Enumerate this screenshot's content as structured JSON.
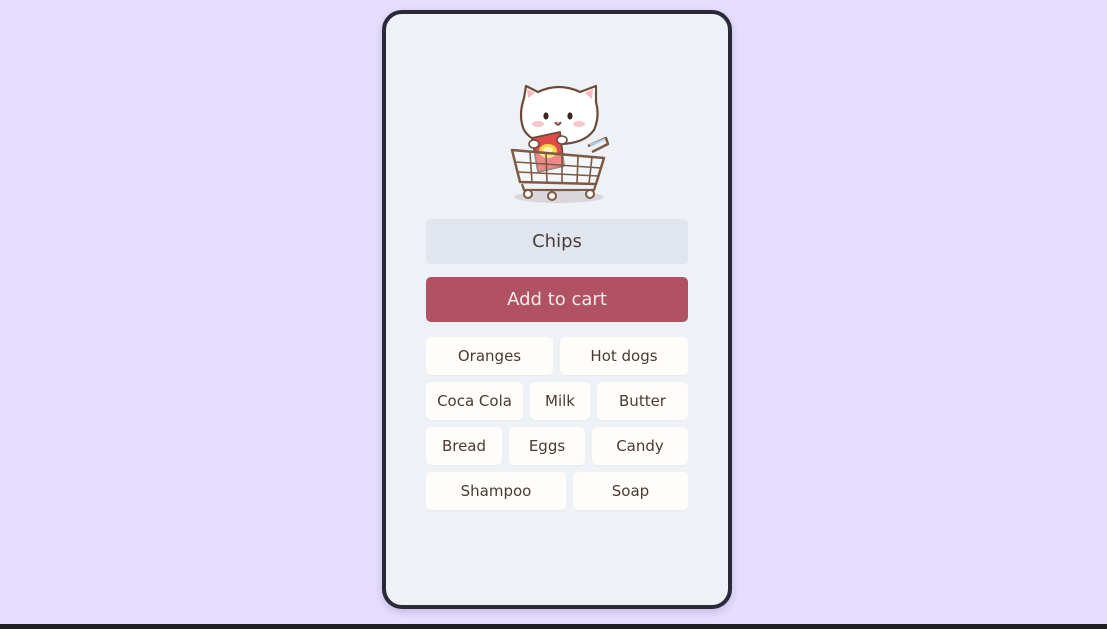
{
  "input": {
    "value": "Chips"
  },
  "add_button": {
    "label": "Add to cart"
  },
  "items": {
    "oranges": "Oranges",
    "hot_dogs": "Hot dogs",
    "coca_cola": "Coca Cola",
    "milk": "Milk",
    "butter": "Butter",
    "bread": "Bread",
    "eggs": "Eggs",
    "candy": "Candy",
    "shampoo": "Shampoo",
    "soap": "Soap"
  },
  "colors": {
    "background": "#e6defe",
    "card": "#eef1f6",
    "accent": "#b05264",
    "chip": "#fefdf9"
  },
  "icons": {
    "mascot": "cat-in-shopping-cart-illustration"
  }
}
